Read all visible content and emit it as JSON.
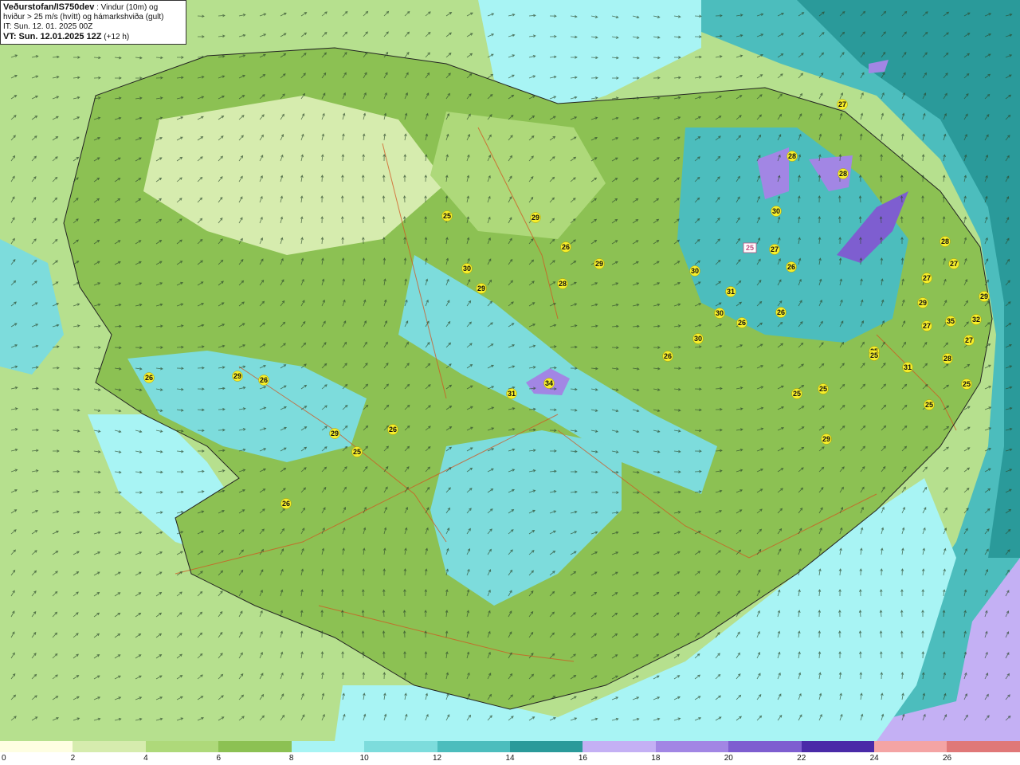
{
  "header": {
    "model": "Veðurstofan/IS750dev",
    "desc1": " : Vindur (10m) og",
    "desc2": "hviður > 25 m/s (hvítt) og hámarkshviða (gult)",
    "it": "IT: Sun. 12. 01. 2025 00Z",
    "vt_bold": "VT: Sun. 12.01.2025 12Z",
    "vt_rest": " (+12 h)"
  },
  "legend": {
    "colors": [
      "#fefee2",
      "#d6ecae",
      "#aed97a",
      "#8cc153",
      "#a8f4f4",
      "#7ddcdc",
      "#4cbdbd",
      "#2a9a9a",
      "#c4b0f4",
      "#a286e4",
      "#7e5ed0",
      "#4a2aa8",
      "#f4a4a4",
      "#e07878"
    ],
    "ticks": [
      "0",
      "2",
      "4",
      "6",
      "8",
      "10",
      "12",
      "14",
      "16",
      "18",
      "20",
      "22",
      "24",
      "26"
    ]
  },
  "gust_labels": [
    {
      "v": "27"
    },
    {
      "v": "28"
    },
    {
      "v": "28"
    },
    {
      "v": "25"
    },
    {
      "v": "29"
    },
    {
      "v": "30"
    },
    {
      "v": "26"
    },
    {
      "v": "29"
    },
    {
      "v": "30"
    },
    {
      "v": "28"
    },
    {
      "v": "29"
    },
    {
      "v": "27"
    },
    {
      "v": "30"
    },
    {
      "v": "25"
    },
    {
      "v": "27"
    },
    {
      "v": "26"
    },
    {
      "v": "28"
    },
    {
      "v": "27"
    },
    {
      "v": "26"
    },
    {
      "v": "31"
    },
    {
      "v": "29"
    },
    {
      "v": "30"
    },
    {
      "v": "26"
    },
    {
      "v": "29"
    },
    {
      "v": "35"
    },
    {
      "v": "32"
    },
    {
      "v": "27"
    },
    {
      "v": "27"
    },
    {
      "v": "30"
    },
    {
      "v": "26"
    },
    {
      "v": "25"
    },
    {
      "v": "28"
    },
    {
      "v": "31"
    },
    {
      "v": "25"
    },
    {
      "v": "34"
    },
    {
      "v": "31"
    },
    {
      "v": "25"
    },
    {
      "v": "25"
    },
    {
      "v": "25"
    },
    {
      "v": "29"
    },
    {
      "v": "29"
    },
    {
      "v": "26"
    },
    {
      "v": "26"
    },
    {
      "v": "29"
    },
    {
      "v": "26"
    },
    {
      "v": "25"
    },
    {
      "v": "26"
    }
  ],
  "white_gust_label": "25"
}
